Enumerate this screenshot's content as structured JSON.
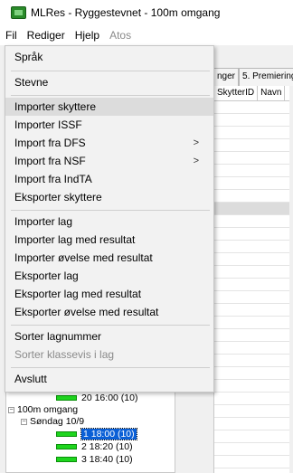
{
  "window": {
    "title": "MLRes - Ryggestevnet - 100m omgang",
    "icon": "app-icon"
  },
  "menubar": {
    "items": [
      {
        "label": "Fil",
        "disabled": false
      },
      {
        "label": "Rediger",
        "disabled": false
      },
      {
        "label": "Hjelp",
        "disabled": false
      },
      {
        "label": "Atos",
        "disabled": true
      }
    ]
  },
  "tabs": {
    "items": [
      "nger",
      "5. Premiering"
    ]
  },
  "grid": {
    "headers": [
      "SkytterID",
      "Navn"
    ]
  },
  "tree": {
    "items": [
      {
        "text": "20 16:00  (10)",
        "level": "leaf"
      },
      {
        "text": "100m omgang",
        "level": "group"
      },
      {
        "text": "Søndag 10/9",
        "level": "day"
      },
      {
        "text": "1 18:00  (10)",
        "level": "leaf"
      },
      {
        "text": "2 18:20  (10)",
        "level": "leaf"
      },
      {
        "text": "3 18:40  (10)",
        "level": "leaf"
      }
    ]
  },
  "menu": {
    "items": [
      {
        "label": "Språk",
        "disabled": false,
        "submenu": false
      },
      {
        "label": "Stevne",
        "disabled": false,
        "submenu": false
      },
      {
        "label": "Importer skyttere",
        "disabled": false,
        "submenu": false,
        "highlighted": true
      },
      {
        "label": "Importer ISSF",
        "disabled": false,
        "submenu": false
      },
      {
        "label": "Import fra DFS",
        "disabled": false,
        "submenu": true
      },
      {
        "label": "Import fra NSF",
        "disabled": false,
        "submenu": true
      },
      {
        "label": "Import fra IndTA",
        "disabled": false,
        "submenu": false
      },
      {
        "label": "Eksporter skyttere",
        "disabled": false,
        "submenu": false
      },
      {
        "label": "Importer lag",
        "disabled": false,
        "submenu": false
      },
      {
        "label": "Importer lag med resultat",
        "disabled": false,
        "submenu": false
      },
      {
        "label": "Importer øvelse med resultat",
        "disabled": false,
        "submenu": false
      },
      {
        "label": "Eksporter lag",
        "disabled": false,
        "submenu": false
      },
      {
        "label": "Eksporter lag med resultat",
        "disabled": false,
        "submenu": false
      },
      {
        "label": "Eksporter øvelse med resultat",
        "disabled": false,
        "submenu": false
      },
      {
        "label": "Sorter lagnummer",
        "disabled": false,
        "submenu": false
      },
      {
        "label": "Sorter klassevis i lag",
        "disabled": true,
        "submenu": false
      },
      {
        "label": "Avslutt",
        "disabled": false,
        "submenu": false
      }
    ],
    "submenu_arrow": ">"
  }
}
